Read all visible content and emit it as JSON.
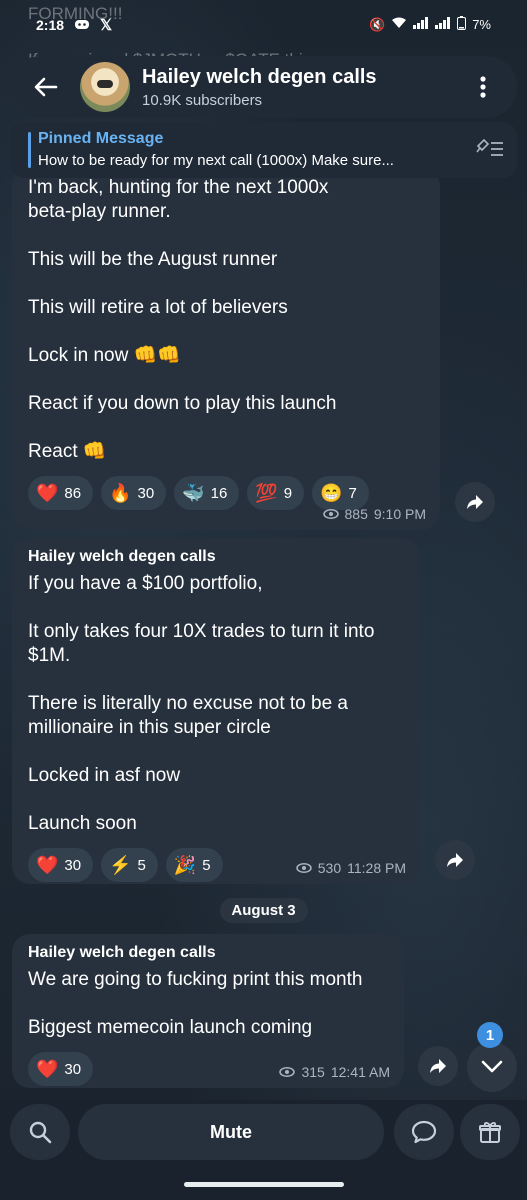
{
  "status_bar": {
    "time": "2:18",
    "battery": "7%"
  },
  "ghost": {
    "line1": "FORMING!!!",
    "line2": "If you missed $JMOTH or $GATE this"
  },
  "header": {
    "title": "Hailey welch degen calls",
    "subtitle": "10.9K subscribers"
  },
  "pinned": {
    "title": "Pinned Message",
    "text": "How to be ready for my next call (1000x)  Make sure..."
  },
  "messages": [
    {
      "sender": "",
      "lines": [
        "I'm back, hunting for the next 1000x",
        "beta-play runner.",
        "",
        "This will be the August runner",
        "",
        "This will retire a lot of believers",
        "",
        "Lock in now 👊👊",
        "",
        "React if you down to play this launch",
        "",
        "React 👊"
      ],
      "reactions": [
        {
          "emoji": "❤️",
          "count": "86"
        },
        {
          "emoji": "🔥",
          "count": "30"
        },
        {
          "emoji": "🐳",
          "count": "16"
        },
        {
          "emoji": "💯",
          "count": "9"
        },
        {
          "emoji": "😁",
          "count": "7"
        }
      ],
      "views": "885",
      "time": "9:10 PM"
    },
    {
      "sender": "Hailey welch degen calls",
      "lines": [
        "If you have a $100 portfolio,",
        "",
        "It only takes four 10X trades to turn it into",
        "$1M.",
        "",
        "There is literally no excuse not to be a",
        "millionaire in this super circle",
        "",
        "Locked in asf now",
        "",
        "Launch soon"
      ],
      "reactions": [
        {
          "emoji": "❤️",
          "count": "30"
        },
        {
          "emoji": "⚡",
          "count": "5"
        },
        {
          "emoji": "🎉",
          "count": "5"
        }
      ],
      "views": "530",
      "time": "11:28 PM"
    },
    {
      "sender": "Hailey welch degen calls",
      "lines": [
        "We are going to fucking print this month",
        "",
        "Biggest memecoin launch coming"
      ],
      "reactions": [
        {
          "emoji": "❤️",
          "count": "30"
        }
      ],
      "views": "315",
      "time": "12:41 AM"
    }
  ],
  "date_divider": "August 3",
  "unread_count": "1",
  "bottom": {
    "mute_label": "Mute"
  },
  "colors": {
    "accent": "#6ab3f3",
    "bubble": "#26313d",
    "badge": "#3e8fe0"
  }
}
